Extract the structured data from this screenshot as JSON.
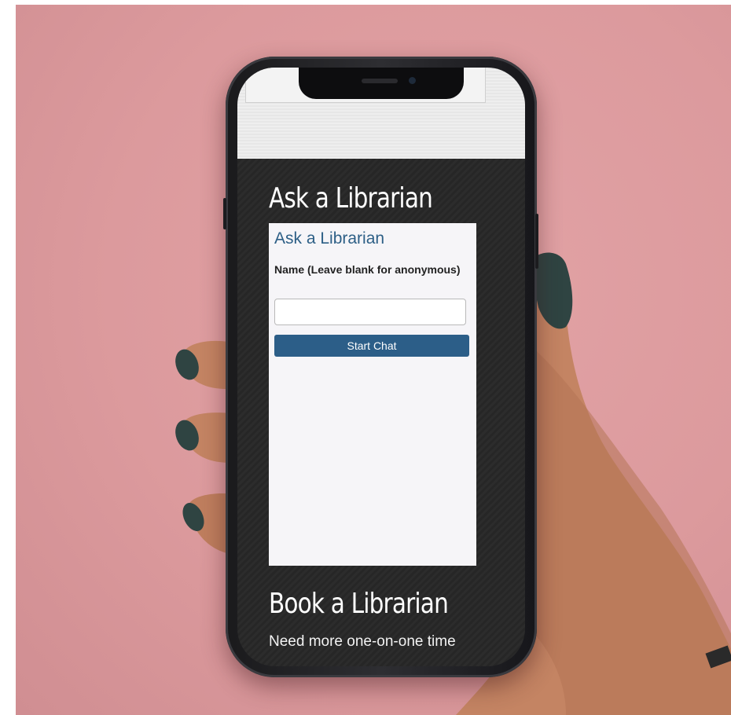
{
  "scene": {
    "background_color": "#dc9a9d",
    "nail_color": "#2f4442",
    "skin_color": "#c48463"
  },
  "phone": {
    "ask_section_title": "Ask a Librarian",
    "widget": {
      "title": "Ask a Librarian",
      "name_label": "Name (Leave blank for anonymous)",
      "name_input_value": "",
      "start_button_label": "Start Chat",
      "accent_color": "#2c5e88"
    },
    "book_section_title": "Book a Librarian",
    "book_section_text": "Need more one-on-one time"
  }
}
